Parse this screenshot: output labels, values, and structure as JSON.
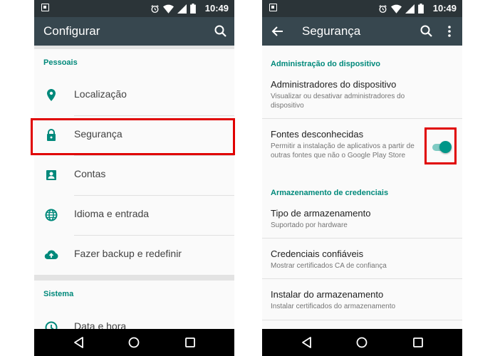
{
  "status_bar": {
    "time": "10:49",
    "icons": [
      "notification-icon",
      "alarm-icon",
      "wifi-icon",
      "signal-icon",
      "battery-icon"
    ]
  },
  "left": {
    "title": "Configurar",
    "section_personal": "Pessoais",
    "items": [
      {
        "label": "Localização",
        "icon": "location-icon"
      },
      {
        "label": "Segurança",
        "icon": "lock-icon"
      },
      {
        "label": "Contas",
        "icon": "account-icon"
      },
      {
        "label": "Idioma e entrada",
        "icon": "globe-icon"
      },
      {
        "label": "Fazer backup e redefinir",
        "icon": "backup-icon"
      }
    ],
    "section_system": "Sistema",
    "system_items": [
      {
        "label": "Data e hora",
        "icon": "clock-icon"
      }
    ]
  },
  "right": {
    "title": "Segurança",
    "section_admin": "Administração do dispositivo",
    "admin_items": [
      {
        "title": "Administradores do dispositivo",
        "subtitle": "Visualizar ou desativar administradores do dispositivo"
      },
      {
        "title": "Fontes desconhecidas",
        "subtitle": "Permitir a instalação de aplicativos a partir de outras fontes que não o Google Play Store",
        "toggle_on": true
      }
    ],
    "section_storage": "Armazenamento de credenciais",
    "storage_items": [
      {
        "title": "Tipo de armazenamento",
        "subtitle": "Suportado por hardware"
      },
      {
        "title": "Credenciais confiáveis",
        "subtitle": "Mostrar certificados CA de confiança"
      },
      {
        "title": "Instalar do armazenamento",
        "subtitle": "Instalar certificados do armazenamento"
      }
    ]
  },
  "colors": {
    "accent": "#00897b",
    "app_bar": "#37474f",
    "status_bar": "#2b3438",
    "highlight": "#e00000"
  }
}
